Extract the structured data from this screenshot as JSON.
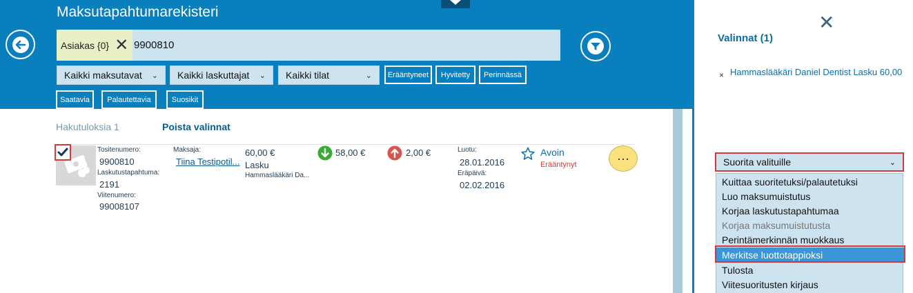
{
  "header": {
    "title": "Maksutapahtumarekisteri",
    "chip_label": "Asiakas {0}",
    "search_value": "9900810",
    "filters": {
      "payment_methods": "Kaikki maksutavat",
      "billers": "Kaikki laskuttajat",
      "statuses": "Kaikki tilat"
    },
    "tags": [
      "Erääntyneet",
      "Hyvitetty",
      "Perinnässä",
      "Saatavia",
      "Palautettavia",
      "Suosikit"
    ]
  },
  "results": {
    "count_label": "Hakutuloksia 1",
    "clear_label": "Poista valinnat",
    "row": {
      "receipt_label": "Tositenumero:",
      "receipt_value": "9900810",
      "billing_label": "Laskutustapahtuma:",
      "billing_value": "2191",
      "reference_label": "Viitenumero:",
      "reference_value": "99008107",
      "payer_label": "Maksaja:",
      "payer_value": "Tiina Testipotil...",
      "amount": "60,00 €",
      "type": "Lasku",
      "biller": "Hammaslääkäri Da...",
      "in_amount": "58,00 €",
      "out_amount": "2,00 €",
      "created_label": "Luotu:",
      "created_value": "28.01.2016",
      "due_label": "Eräpäivä:",
      "due_value": "02.02.2016",
      "status": "Avoin",
      "substatus": "Erääntynyt",
      "more": "···"
    }
  },
  "panel": {
    "close_icon": "close-icon",
    "selections_title": "Valinnat (1)",
    "selection_item": "Hammaslääkäri Daniel Dentist Lasku 60,00",
    "remove_mark": "×",
    "action_select_label": "Suorita valituille",
    "actions": [
      {
        "label": "Kuittaa suoritetuksi/palautetuksi",
        "state": "normal"
      },
      {
        "label": "Luo maksumuistutus",
        "state": "normal"
      },
      {
        "label": "Korjaa laskutustapahtumaa",
        "state": "normal"
      },
      {
        "label": "Korjaa maksumuistutusta",
        "state": "disabled"
      },
      {
        "label": "Perintämerkinnän muokkaus",
        "state": "normal"
      },
      {
        "label": "Merkitse luottotappioksi",
        "state": "selected"
      },
      {
        "label": "Tulosta",
        "state": "normal"
      },
      {
        "label": "Viitesuoritusten kirjaus",
        "state": "normal"
      }
    ]
  },
  "colors": {
    "header_blue": "#0a7fbd",
    "field_bg": "#cde3ef",
    "highlight_red": "#d33b3b",
    "selected_option": "#3a96d8",
    "in_green": "#3aaa35",
    "out_red": "#d9534f",
    "more_yellow": "#f9e17f"
  }
}
